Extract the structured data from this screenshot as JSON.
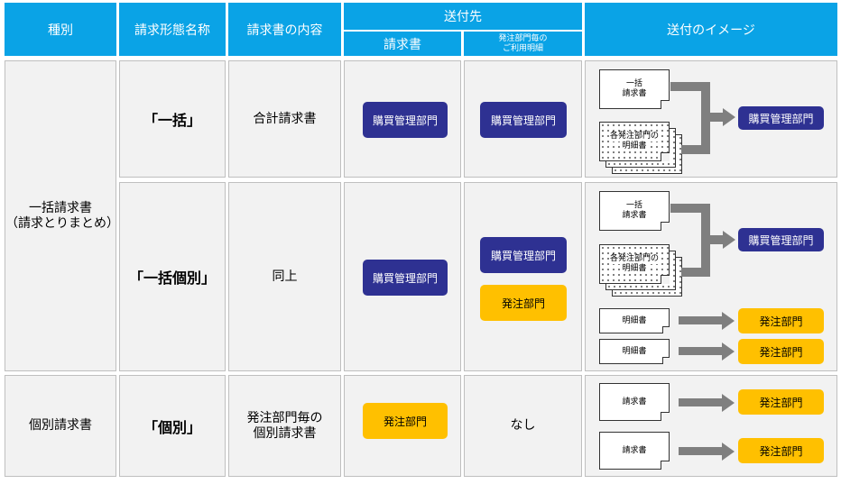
{
  "header": {
    "type": "種別",
    "billing_name": "請求形態名称",
    "content": "請求書の内容",
    "destination": "送付先",
    "dest_invoice": "請求書",
    "dest_detail_line1": "発注部門毎の",
    "dest_detail_line2": "ご利用明細",
    "image": "送付のイメージ"
  },
  "rows": {
    "group_type_line1": "一括請求書",
    "group_type_line2": "（請求とりまとめ）",
    "lump": {
      "name": "「一括」",
      "content": "合計請求書",
      "invoice_dest": "購買管理部門",
      "detail_dest": "購買管理部門",
      "img_doc1_line1": "一括",
      "img_doc1_line2": "請求書",
      "img_doc2_line1": "各発注部門の",
      "img_doc2_line2": "明細書",
      "img_target": "購買管理部門"
    },
    "lump_individual": {
      "name": "「一括個別」",
      "content": "同上",
      "invoice_dest": "購買管理部門",
      "detail_dest1": "購買管理部門",
      "detail_dest2": "発注部門",
      "img_doc1_line1": "一括",
      "img_doc1_line2": "請求書",
      "img_doc2_line1": "各発注部門の",
      "img_doc2_line2": "明細書",
      "img_target1": "購買管理部門",
      "img_doc3": "明細書",
      "img_target2": "発注部門",
      "img_doc4": "明細書",
      "img_target3": "発注部門"
    },
    "individual": {
      "type": "個別請求書",
      "name": "「個別」",
      "content_line1": "発注部門毎の",
      "content_line2": "個別請求書",
      "invoice_dest": "発注部門",
      "detail_dest": "なし",
      "img_doc1": "請求書",
      "img_target1": "発注部門",
      "img_doc2": "請求書",
      "img_target2": "発注部門"
    }
  },
  "colors": {
    "header": "#0aa3e6",
    "navy": "#2e3192",
    "gold": "#ffc000",
    "cell": "#f2f2f2",
    "arrow": "#7f7f7f"
  },
  "icons": [
    "document-icon",
    "stacked-documents-icon",
    "arrow-right-icon"
  ]
}
